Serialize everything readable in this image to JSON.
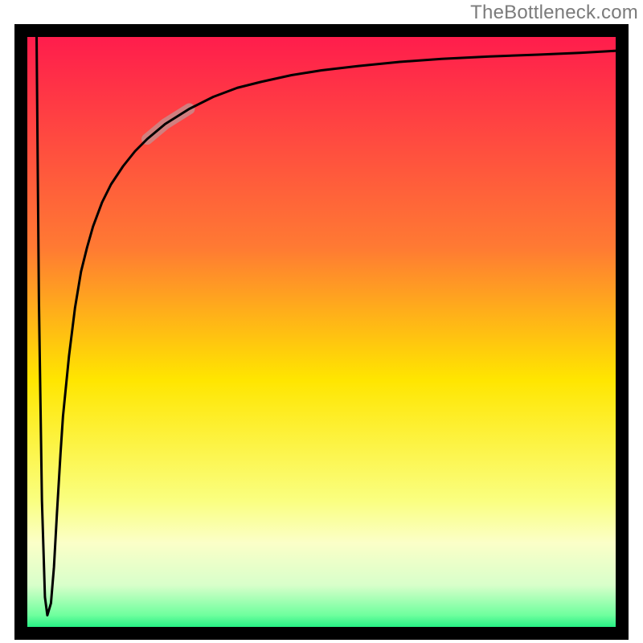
{
  "watermark": "TheBottleneck.com",
  "chart_data": {
    "type": "line",
    "title": "",
    "xlabel": "",
    "ylabel": "",
    "xlim": [
      0,
      100
    ],
    "ylim": [
      0,
      100
    ],
    "grid": false,
    "legend": false,
    "gradient_stops": [
      {
        "offset": 0.0,
        "color": "#ff1a4d"
      },
      {
        "offset": 0.36,
        "color": "#ff7a33"
      },
      {
        "offset": 0.58,
        "color": "#ffe600"
      },
      {
        "offset": 0.78,
        "color": "#faff80"
      },
      {
        "offset": 0.85,
        "color": "#fbffc8"
      },
      {
        "offset": 0.92,
        "color": "#d8ffca"
      },
      {
        "offset": 0.97,
        "color": "#6eff9e"
      },
      {
        "offset": 1.0,
        "color": "#00e676"
      }
    ],
    "highlight_segment": {
      "x_start": 21,
      "x_end": 28,
      "color": "#c98a8a",
      "width": 14
    },
    "series": [
      {
        "name": "curve",
        "color": "#000000",
        "width": 3,
        "x": [
          2.6,
          3.0,
          3.5,
          4.0,
          4.4,
          5.0,
          5.5,
          6.0,
          6.6,
          7.0,
          8.0,
          9.0,
          10.0,
          11.0,
          12.0,
          13.5,
          15.0,
          17.0,
          19.0,
          21.0,
          24.0,
          28.0,
          32.0,
          36.0,
          40.0,
          45.0,
          50.0,
          56.0,
          63.0,
          70.0,
          78.0,
          86.0,
          93.0,
          100.0
        ],
        "y": [
          100.0,
          55.0,
          22.0,
          6.0,
          3.0,
          5.0,
          11.0,
          20.0,
          30.0,
          36.0,
          46.0,
          54.0,
          60.0,
          64.0,
          67.5,
          71.5,
          74.5,
          77.5,
          80.0,
          82.0,
          84.5,
          87.0,
          89.0,
          90.5,
          91.5,
          92.6,
          93.4,
          94.1,
          94.8,
          95.3,
          95.7,
          96.0,
          96.3,
          96.7
        ]
      }
    ]
  }
}
